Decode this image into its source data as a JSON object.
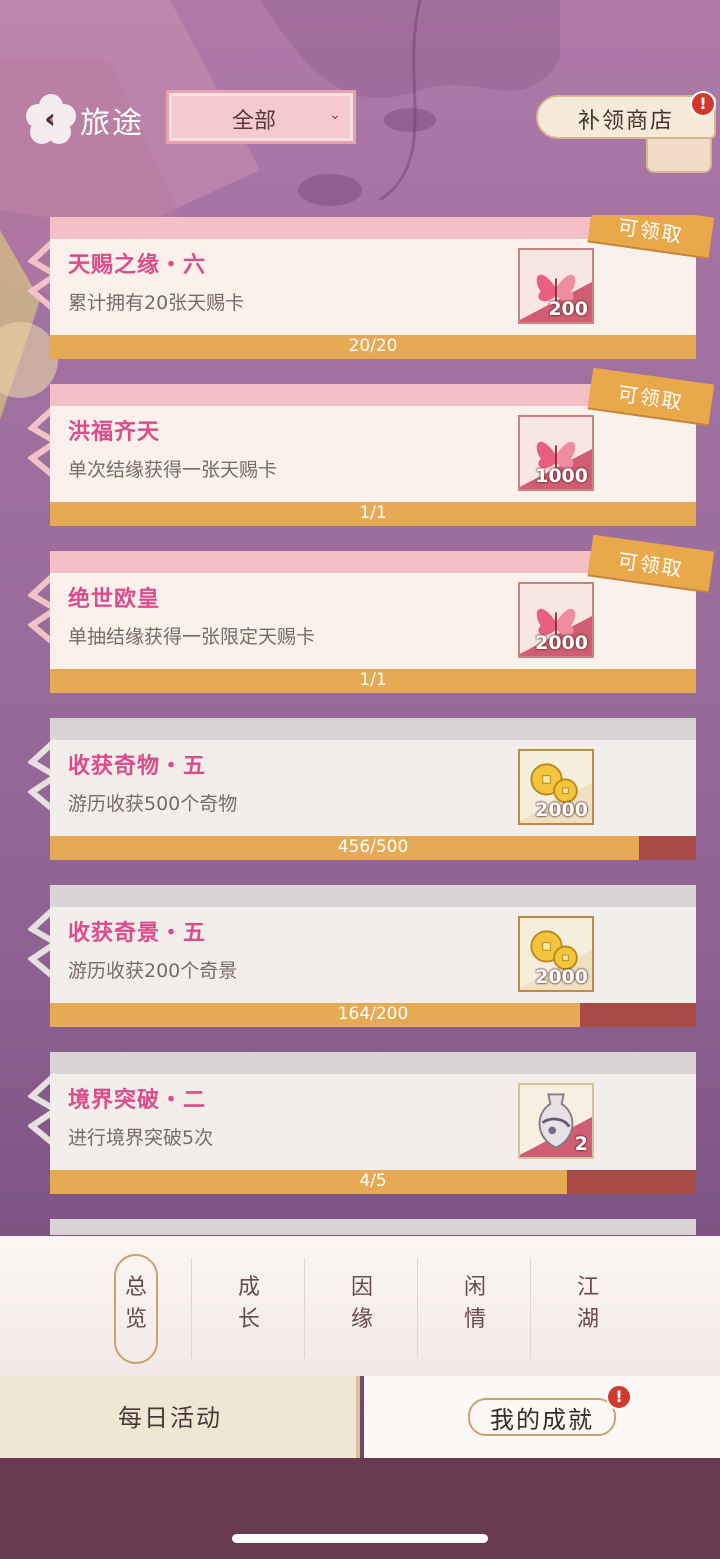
{
  "header": {
    "title": "旅途",
    "filter_value": "全部",
    "shop_label": "补领商店",
    "shop_badge": "!"
  },
  "tasks": [
    {
      "name": "天赐之缘・六",
      "desc": "累计拥有20张天赐卡",
      "reward_qty": "200",
      "reward_icon": "butterfly-card-icon",
      "progress_text": "20/20",
      "progress": 1.0,
      "claim_label": "可领取"
    },
    {
      "name": "洪福齐天",
      "desc": "单次结缘获得一张天赐卡",
      "reward_qty": "1000",
      "reward_icon": "butterfly-card-icon",
      "progress_text": "1/1",
      "progress": 1.0,
      "claim_label": "可领取"
    },
    {
      "name": "绝世欧皇",
      "desc": "单抽结缘获得一张限定天赐卡",
      "reward_qty": "2000",
      "reward_icon": "butterfly-card-icon",
      "progress_text": "1/1",
      "progress": 1.0,
      "claim_label": "可领取"
    },
    {
      "name": "收获奇物・五",
      "desc": "游历收获500个奇物",
      "reward_qty": "2000",
      "reward_icon": "gold-coins-icon",
      "progress_text": "456/500",
      "progress": 0.912
    },
    {
      "name": "收获奇景・五",
      "desc": "游历收获200个奇景",
      "reward_qty": "2000",
      "reward_icon": "gold-coins-icon",
      "progress_text": "164/200",
      "progress": 0.82
    },
    {
      "name": "境界突破・二",
      "desc": "进行境界突破5次",
      "reward_qty": "2",
      "reward_icon": "porcelain-vase-icon",
      "progress_text": "4/5",
      "progress": 0.8
    }
  ],
  "tabs": [
    {
      "label": "总\n览",
      "active": true
    },
    {
      "label": "成\n长"
    },
    {
      "label": "因\n缘"
    },
    {
      "label": "闲\n情"
    },
    {
      "label": "江\n湖"
    }
  ],
  "bottom_nav": {
    "daily": "每日活动",
    "mine": "我的成就",
    "mine_badge": "!"
  },
  "colors": {
    "accent_pink": "#dc4c8a",
    "progress_fill": "#e6a954",
    "progress_track": "#a84a46",
    "badge_red": "#d23a2c"
  }
}
